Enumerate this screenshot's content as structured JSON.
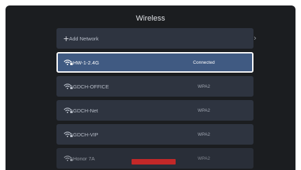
{
  "window": {
    "title": "Wireless"
  },
  "add_network": {
    "label": "Add Network",
    "chevron": "›"
  },
  "networks": [
    {
      "ssid": "HW-1-2.4G",
      "status": "Connected",
      "icon": "wifi-lock-icon",
      "selected": true
    },
    {
      "ssid": "GDCH-OFFICE",
      "status": "WPA2",
      "icon": "wifi-lock-icon",
      "selected": false
    },
    {
      "ssid": "GDCH-Net",
      "status": "WPA2",
      "icon": "wifi-lock-icon",
      "selected": false
    },
    {
      "ssid": "GDCH-VIP",
      "status": "WPA2",
      "icon": "wifi-lock-icon",
      "selected": false
    },
    {
      "ssid": "Honor 7A",
      "status": "WPA2",
      "icon": "wifi-lock-icon",
      "selected": false
    }
  ],
  "colors": {
    "background": "#1b1d20",
    "row": "#2e3440",
    "selected_row": "#405a82",
    "badge": "#c32828"
  }
}
